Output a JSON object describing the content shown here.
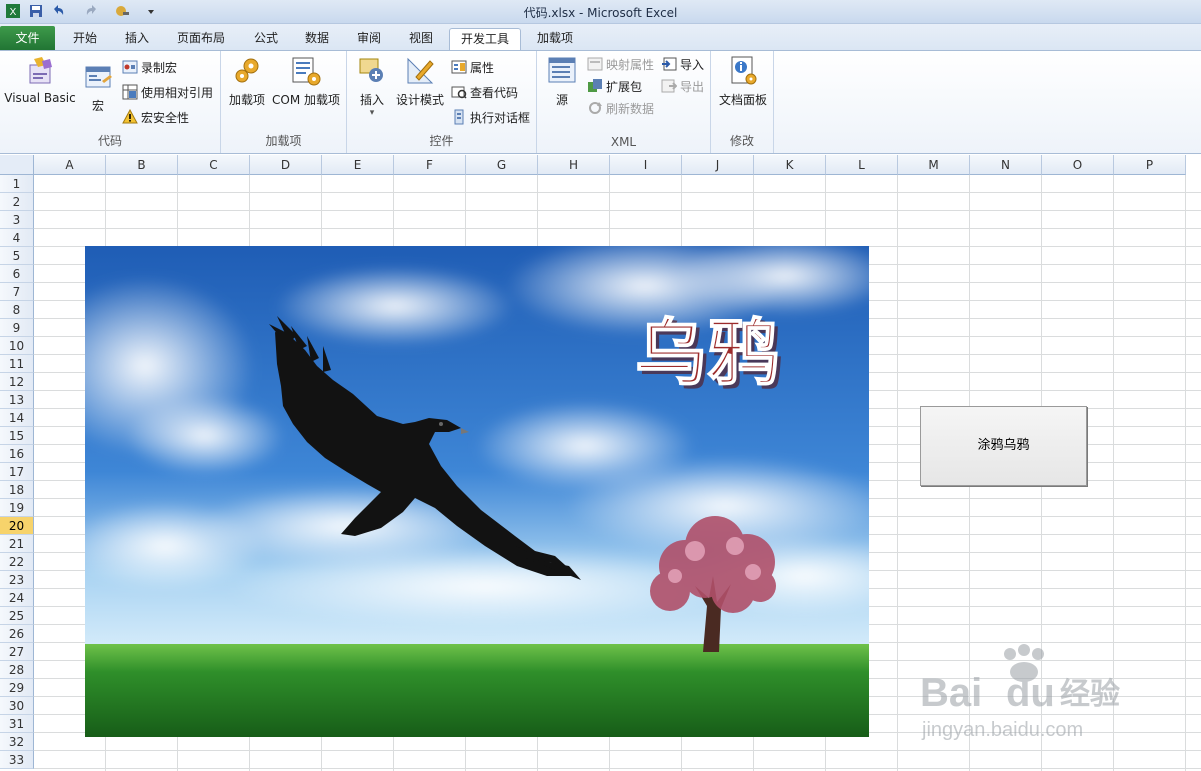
{
  "window": {
    "title": "代码.xlsx - Microsoft Excel"
  },
  "tabs": {
    "file": "文件",
    "items": [
      "开始",
      "插入",
      "页面布局",
      "公式",
      "数据",
      "审阅",
      "视图",
      "开发工具",
      "加载项"
    ],
    "active": "开发工具"
  },
  "ribbon": {
    "code_group": {
      "label": "代码",
      "visual_basic": "Visual Basic",
      "macros": "宏",
      "record_macro": "录制宏",
      "relative_ref": "使用相对引用",
      "macro_security": "宏安全性"
    },
    "addins_group": {
      "label": "加载项",
      "addins": "加载项",
      "com_addins": "COM 加载项"
    },
    "controls_group": {
      "label": "控件",
      "insert": "插入",
      "design_mode": "设计模式",
      "properties": "属性",
      "view_code": "查看代码",
      "run_dialog": "执行对话框"
    },
    "xml_group": {
      "label": "XML",
      "source": "源",
      "map_properties": "映射属性",
      "expansion_packs": "扩展包",
      "refresh_data": "刷新数据",
      "import": "导入",
      "export": "导出"
    },
    "modify_group": {
      "label": "修改",
      "document_panel": "文档面板"
    }
  },
  "sheet": {
    "columns": [
      "A",
      "B",
      "C",
      "D",
      "E",
      "F",
      "G",
      "H",
      "I",
      "J",
      "K",
      "L",
      "M",
      "N",
      "O",
      "P"
    ],
    "rows": [
      "1",
      "2",
      "3",
      "4",
      "5",
      "6",
      "7",
      "8",
      "9",
      "10",
      "11",
      "12",
      "13",
      "14",
      "15",
      "16",
      "17",
      "18",
      "19",
      "20",
      "21",
      "22",
      "23",
      "24",
      "25",
      "26",
      "27",
      "28",
      "29",
      "30",
      "31",
      "32",
      "33"
    ],
    "selected_row": "20"
  },
  "picture": {
    "caption": "乌鸦"
  },
  "form_button": {
    "label": "涂鸦乌鸦"
  },
  "watermark": {
    "brand": "Bai",
    "brand2": "du",
    "suffix": "经验",
    "url": "jingyan.baidu.com"
  },
  "colors": {
    "file_tab": "#217534",
    "selected_row_header": "#f7d36b",
    "caption": "#9c2b2b"
  }
}
